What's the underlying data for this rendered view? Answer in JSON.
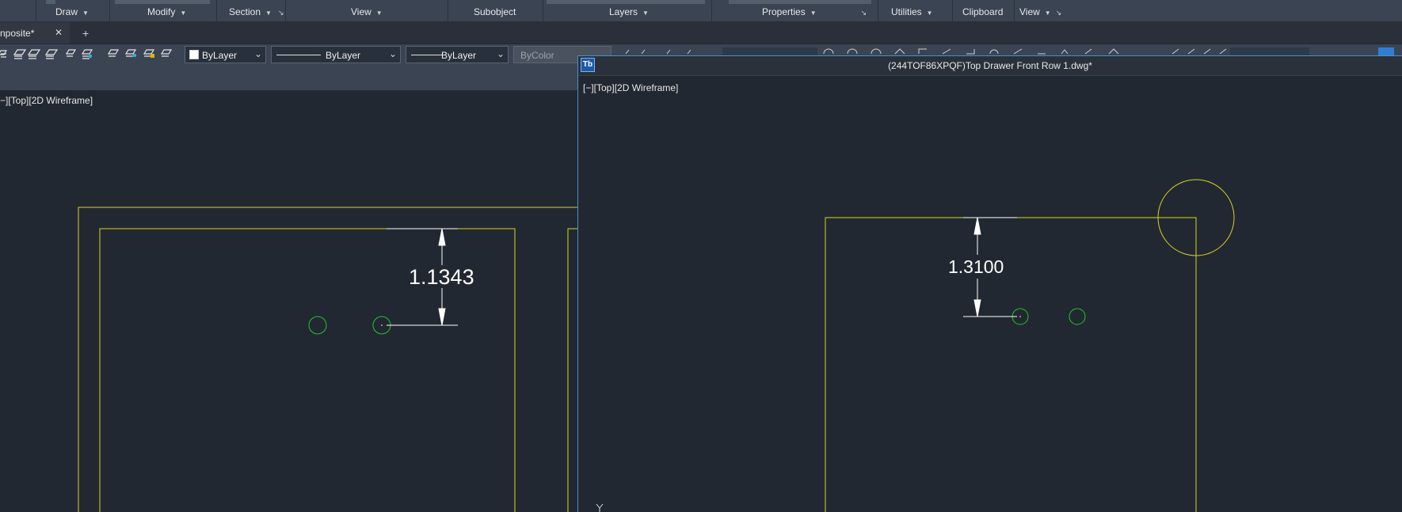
{
  "ribbon": {
    "panels": [
      {
        "label": "Draw",
        "caret": "▼"
      },
      {
        "label": "Modify",
        "caret": "▼"
      },
      {
        "label": "Section",
        "caret": "▼",
        "launcher": "↘"
      },
      {
        "label": "View",
        "caret": "▼"
      },
      {
        "label": "Subobject"
      },
      {
        "label": "Layers",
        "caret": "▼"
      },
      {
        "label": "Properties",
        "caret": "▼",
        "launcher": "↘"
      },
      {
        "label": "Utilities",
        "caret": "▼"
      },
      {
        "label": "Clipboard"
      },
      {
        "label": "View",
        "caret": "▼",
        "launcher": "↘"
      }
    ]
  },
  "document_tab": {
    "label": "nposite*",
    "close": "✕",
    "new_tab": "+"
  },
  "toolbar": {
    "color_combo": "ByLayer",
    "linetype_combo": "ByLayer",
    "lineweight_combo": "ByLayer",
    "plotstyle_combo": "ByColor"
  },
  "left_viewport": {
    "label": "−][Top][2D Wireframe]",
    "dimension": "1.1343"
  },
  "right_window": {
    "icon": "Tb",
    "title": "(244TOF86XPQF)Top Drawer Front Row 1.dwg*",
    "viewport_label": "[−][Top][2D Wireframe]",
    "dimension": "1.3100",
    "ucs_glyph": "Y"
  },
  "colors": {
    "geometry": "#d6d31f",
    "circles": "#23c42a",
    "dimension": "#ffffff",
    "window_border": "#3e93d6",
    "background": "#222831"
  }
}
